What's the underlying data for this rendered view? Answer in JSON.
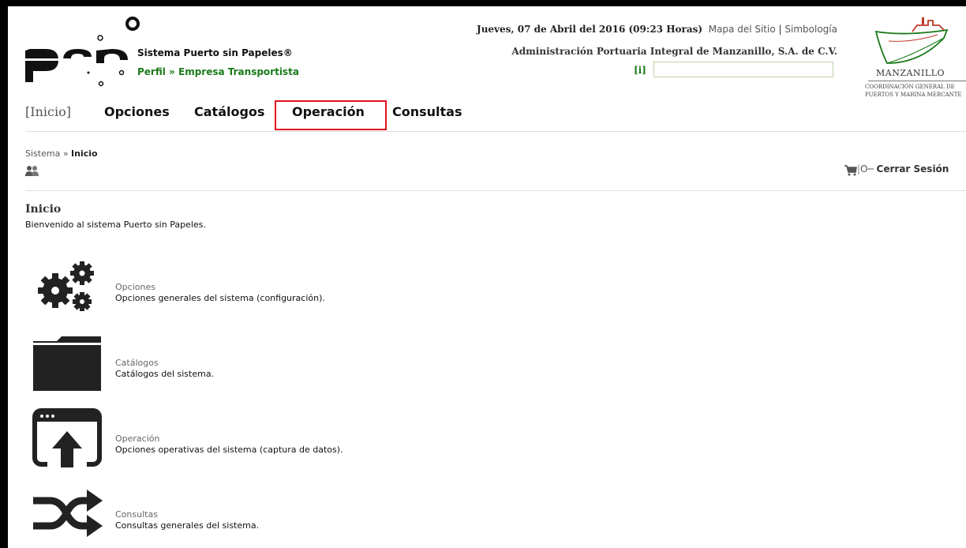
{
  "header": {
    "site_title": "Sistema Puerto sin Papeles®",
    "profile_label": "Perfil",
    "profile_sep": "»",
    "profile_value": "Empresa Transportista",
    "date": "Jueves, 07 de Abril del 2016 (09:23 Horas)",
    "sitemap_link": "Mapa del Sitio",
    "links_sep": "|",
    "symbology_link": "Simbología",
    "org_name": "Administración Portuaria Integral de Manzanillo, S.A. de C.V.",
    "info_link": "[i]",
    "search_value": ""
  },
  "partner_logo": {
    "name": "MANZANILLO",
    "sub_line1": "COORDINACIÓN GENERAL DE",
    "sub_line2": "PUERTOS Y MARINA MERCANTE"
  },
  "menu": {
    "inicio": "[Inicio]",
    "opciones": "Opciones",
    "catalogos": "Catálogos",
    "operacion": "Operación",
    "consultas": "Consultas"
  },
  "breadcrumb": {
    "root": "Sistema",
    "sep": "»",
    "current": "Inicio"
  },
  "session": {
    "sep": "|",
    "logout_label": "Cerrar Sesión"
  },
  "page": {
    "heading": "Inicio",
    "welcome": "Bienvenido al sistema Puerto sin Papeles."
  },
  "modules": [
    {
      "title": "Opciones",
      "description": "Opciones generales del sistema (configuración).",
      "icon": "gears-icon"
    },
    {
      "title": "Catálogos",
      "description": "Catálogos del sistema.",
      "icon": "folder-icon"
    },
    {
      "title": "Operación",
      "description": "Opciones operativas del sistema (captura de datos).",
      "icon": "upload-window-icon"
    },
    {
      "title": "Consultas",
      "description": "Consultas generales del sistema.",
      "icon": "shuffle-icon"
    }
  ],
  "colors": {
    "accent_green": "#1a7a1a",
    "highlight_red": "#e0141c"
  }
}
